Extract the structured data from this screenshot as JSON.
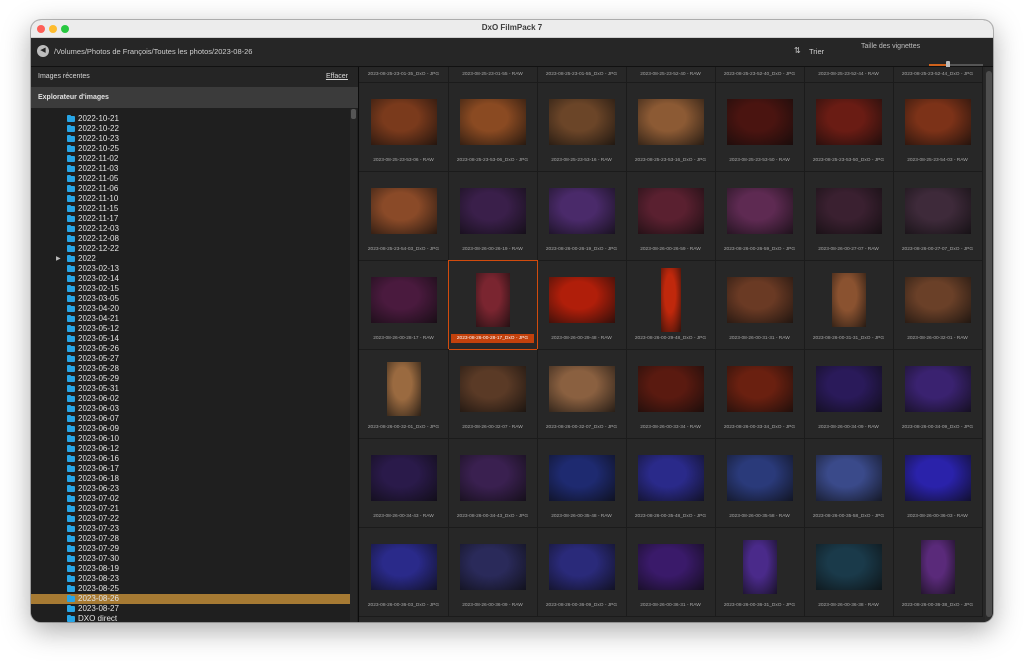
{
  "window": {
    "title": "DxO FilmPack 7"
  },
  "pathbar": {
    "back_icon": "circle-arrow-left-icon",
    "path": "/Volumes/Photos de François/Toutes les photos/2023-08-26",
    "sort_label": "Trier",
    "thumb_size_label": "Taille des vignettes",
    "thumb_size_value": 0.35
  },
  "sidebar": {
    "recent_label": "Images récentes",
    "clear_label": "Effacer",
    "explorer_label": "Explorateur d'images"
  },
  "colors": {
    "accent": "#c2410c",
    "folder": "#27a5e6",
    "selected_folder": "#a67a33"
  },
  "folders": [
    {
      "label": "2022-10-21"
    },
    {
      "label": "2022-10-22"
    },
    {
      "label": "2022-10-23"
    },
    {
      "label": "2022-10-25"
    },
    {
      "label": "2022-11-02"
    },
    {
      "label": "2022-11-03"
    },
    {
      "label": "2022-11-05"
    },
    {
      "label": "2022-11-06"
    },
    {
      "label": "2022-11-10"
    },
    {
      "label": "2022-11-15"
    },
    {
      "label": "2022-11-17"
    },
    {
      "label": "2022-12-03"
    },
    {
      "label": "2022-12-08"
    },
    {
      "label": "2022-12-22"
    },
    {
      "label": "2022",
      "expandable": true
    },
    {
      "label": "2023-02-13"
    },
    {
      "label": "2023-02-14"
    },
    {
      "label": "2023-02-15"
    },
    {
      "label": "2023-03-05"
    },
    {
      "label": "2023-04-20"
    },
    {
      "label": "2023-04-21"
    },
    {
      "label": "2023-05-12"
    },
    {
      "label": "2023-05-14"
    },
    {
      "label": "2023-05-26"
    },
    {
      "label": "2023-05-27"
    },
    {
      "label": "2023-05-28"
    },
    {
      "label": "2023-05-29"
    },
    {
      "label": "2023-05-31"
    },
    {
      "label": "2023-06-02"
    },
    {
      "label": "2023-06-03"
    },
    {
      "label": "2023-06-07"
    },
    {
      "label": "2023-06-09"
    },
    {
      "label": "2023-06-10"
    },
    {
      "label": "2023-06-12"
    },
    {
      "label": "2023-06-16"
    },
    {
      "label": "2023-06-17"
    },
    {
      "label": "2023-06-18"
    },
    {
      "label": "2023-06-23"
    },
    {
      "label": "2023-07-02"
    },
    {
      "label": "2023-07-21"
    },
    {
      "label": "2023-07-22"
    },
    {
      "label": "2023-07-23"
    },
    {
      "label": "2023-07-28"
    },
    {
      "label": "2023-07-29"
    },
    {
      "label": "2023-07-30"
    },
    {
      "label": "2023-08-19"
    },
    {
      "label": "2023-08-23"
    },
    {
      "label": "2023-08-25"
    },
    {
      "label": "2023-08-26",
      "selected": true
    },
    {
      "label": "2023-08-27"
    },
    {
      "label": "DXO direct"
    }
  ],
  "grid": {
    "header_captions": [
      "2023-08-25-23-01-35_DxO - JPG",
      "2023-08-25-23-01-55 - RAW",
      "2023-08-25-23-01-55_DxO - JPG",
      "2023-08-25-23-52-40 - RAW",
      "2023-08-25-23-52-40_DxO - JPG",
      "2023-08-25-23-52-44 - RAW",
      "2023-08-25-23-52-44_DxO - JPG"
    ],
    "rows": [
      [
        {
          "caption": "2023-08-25-23-53-06 - RAW",
          "tone": "#7a3a1c",
          "orientation": "landscape"
        },
        {
          "caption": "2023-08-25-23-53-06_DxO - JPG",
          "tone": "#8a4a22",
          "orientation": "landscape"
        },
        {
          "caption": "2023-08-25-23-53-16 - RAW",
          "tone": "#6b4528",
          "orientation": "landscape"
        },
        {
          "caption": "2023-08-25-23-53-16_DxO - JPG",
          "tone": "#8c5a34",
          "orientation": "landscape"
        },
        {
          "caption": "2023-08-25-23-53-50 - RAW",
          "tone": "#4a1410",
          "orientation": "landscape"
        },
        {
          "caption": "2023-08-25-23-53-50_DxO - JPG",
          "tone": "#6a1c14",
          "orientation": "landscape"
        },
        {
          "caption": "2023-08-25-23-54-03 - RAW",
          "tone": "#7c3218",
          "orientation": "landscape"
        }
      ],
      [
        {
          "caption": "2023-08-25-23-54-03_DxO - JPG",
          "tone": "#8a4a28",
          "orientation": "landscape"
        },
        {
          "caption": "2023-08-26-00-26-19 - RAW",
          "tone": "#3a1f4a",
          "orientation": "landscape"
        },
        {
          "caption": "2023-08-26-00-26-19_DxO - JPG",
          "tone": "#4a2a6a",
          "orientation": "landscape"
        },
        {
          "caption": "2023-08-26-00-26-59 - RAW",
          "tone": "#5a2030",
          "orientation": "landscape"
        },
        {
          "caption": "2023-08-26-00-26-59_DxO - JPG",
          "tone": "#5e2a52",
          "orientation": "landscape"
        },
        {
          "caption": "2023-08-26-00-27-07 - RAW",
          "tone": "#3a2030",
          "orientation": "landscape"
        },
        {
          "caption": "2023-08-26-00-27-07_DxO - JPG",
          "tone": "#3e2a3a",
          "orientation": "landscape"
        }
      ],
      [
        {
          "caption": "2023-08-26-00-28-17 - RAW",
          "tone": "#4a1a3e",
          "orientation": "landscape"
        },
        {
          "caption": "2023-08-26-00-28-17_DxO - JPG",
          "tone": "#7a2530",
          "orientation": "portrait",
          "selected": true
        },
        {
          "caption": "2023-08-26-00-29-48 - RAW",
          "tone": "#b01e0a",
          "orientation": "landscape"
        },
        {
          "caption": "2023-08-26-00-29-48_DxO - JPG",
          "tone": "#c0280c",
          "orientation": "portrait-narrow"
        },
        {
          "caption": "2023-08-26-00-31-31 - RAW",
          "tone": "#6a3a24",
          "orientation": "landscape"
        },
        {
          "caption": "2023-08-26-00-31-31_DxO - JPG",
          "tone": "#8a5230",
          "orientation": "portrait"
        },
        {
          "caption": "2023-08-26-00-32-01 - RAW",
          "tone": "#6a4028",
          "orientation": "landscape"
        }
      ],
      [
        {
          "caption": "2023-08-26-00-32-01_DxO - JPG",
          "tone": "#9a6a40",
          "orientation": "portrait"
        },
        {
          "caption": "2023-08-26-00-32-07 - RAW",
          "tone": "#5a3a26",
          "orientation": "landscape"
        },
        {
          "caption": "2023-08-26-00-32-07_DxO - JPG",
          "tone": "#8a6040",
          "orientation": "landscape"
        },
        {
          "caption": "2023-08-26-00-33-34 - RAW",
          "tone": "#5a1a10",
          "orientation": "landscape"
        },
        {
          "caption": "2023-08-26-00-33-34_DxO - JPG",
          "tone": "#6a2010",
          "orientation": "landscape"
        },
        {
          "caption": "2023-08-26-00-34-09 - RAW",
          "tone": "#2a1a5a",
          "orientation": "landscape"
        },
        {
          "caption": "2023-08-26-00-34-09_DxO - JPG",
          "tone": "#3a2270",
          "orientation": "landscape"
        }
      ],
      [
        {
          "caption": "2023-08-26-00-34-43 - RAW",
          "tone": "#2a1a4a",
          "orientation": "landscape"
        },
        {
          "caption": "2023-08-26-00-34-43_DxO - JPG",
          "tone": "#3a2050",
          "orientation": "landscape"
        },
        {
          "caption": "2023-08-26-00-35-48 - RAW",
          "tone": "#1e2a70",
          "orientation": "landscape"
        },
        {
          "caption": "2023-08-26-00-35-48_DxO - JPG",
          "tone": "#2a2a8a",
          "orientation": "landscape"
        },
        {
          "caption": "2023-08-26-00-35-58 - RAW",
          "tone": "#2a3a7a",
          "orientation": "landscape"
        },
        {
          "caption": "2023-08-26-00-35-58_DxO - JPG",
          "tone": "#3a4a8a",
          "orientation": "landscape"
        },
        {
          "caption": "2023-08-26-00-36-03 - RAW",
          "tone": "#2a22aa",
          "orientation": "landscape"
        }
      ],
      [
        {
          "caption": "2023-08-26-00-36-03_DxO - JPG",
          "tone": "#2a2a8a",
          "orientation": "landscape"
        },
        {
          "caption": "2023-08-26-00-36-09 - RAW",
          "tone": "#2a2a5a",
          "orientation": "landscape"
        },
        {
          "caption": "2023-08-26-00-36-09_DxO - JPG",
          "tone": "#2a2a7a",
          "orientation": "landscape"
        },
        {
          "caption": "2023-08-26-00-36-31 - RAW",
          "tone": "#3a1a6a",
          "orientation": "landscape"
        },
        {
          "caption": "2023-08-26-00-36-31_DxO - JPG",
          "tone": "#4a2a8a",
          "orientation": "portrait"
        },
        {
          "caption": "2023-08-26-00-36-38 - RAW",
          "tone": "#1a3a4a",
          "orientation": "landscape"
        },
        {
          "caption": "2023-08-26-00-36-38_DxO - JPG",
          "tone": "#5a2a7a",
          "orientation": "portrait"
        }
      ]
    ]
  }
}
